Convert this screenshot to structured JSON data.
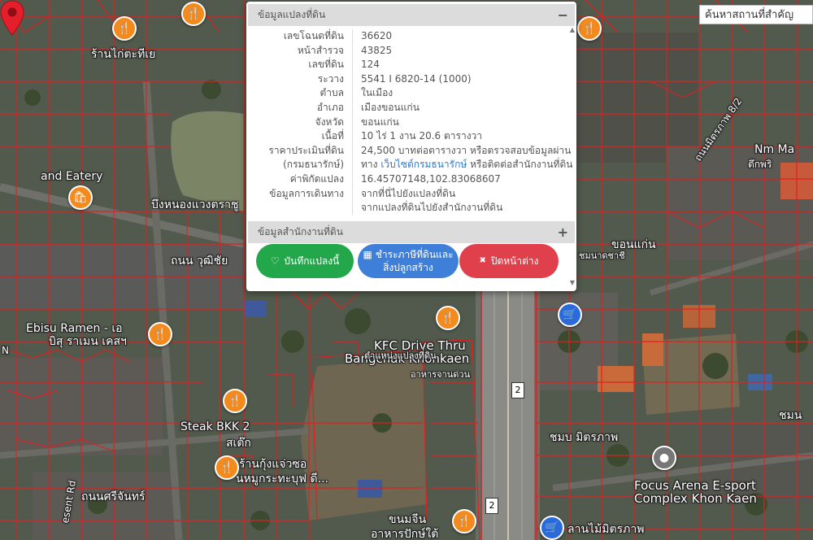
{
  "search": {
    "placeholder": "ค้นหาสถานที่สำคัญ"
  },
  "map_labels": {
    "label_1": "ร้านไก่ตะทีเย",
    "label_2": "and Eatery",
    "label_3": "บึงหนองแวงตราชู",
    "label_4": "ถนน วุฒิชัย",
    "label_5": "Ebisu Ramen - เอ",
    "label_6": "บิสุ ราเมน เคสฯ",
    "label_7": "Steak BKK 2",
    "label_8": "สเต๊ก",
    "label_9": "ร้านกุ้งแจ่วซอ",
    "label_10": "นหมูกระทะบุฟ ดี...",
    "label_11": "ถนนศรีจันทร์",
    "label_12": "KFC Drive Thru",
    "label_13": "Bangchak Khonkaen",
    "label_14": "ตำแหน่งแปลงที่ดิน",
    "label_15": "อาหารจานด่วน",
    "label_16": "Focus Arena E-sport",
    "label_17": "Complex Khon Kaen",
    "label_18": "ลานไม้มิตรภาพ",
    "label_19": "ชมนาดชาชี",
    "label_20": "ขอนแก่น",
    "label_21": "ชมบ มิตรภาพ",
    "label_22": "Nm Ma",
    "label_23": "ตึกพริ",
    "label_24": "ถนนมิตรภาพ 8/2",
    "label_25": "ขนมจีน",
    "label_26": "อาหารปักษ์ใต้",
    "label_27": "ชมน",
    "label_28": "esent Rd",
    "label_29": "N",
    "shield_1": "2",
    "shield_2": "2"
  },
  "panel": {
    "land_section_title": "ข้อมูลแปลงที่ดิน",
    "land_section_toggle": "−",
    "rows": [
      {
        "key": "เลขโฉนดที่ดิน",
        "value": "36620"
      },
      {
        "key": "หน้าสำรวจ",
        "value": "43825"
      },
      {
        "key": "เลขที่ดิน",
        "value": "124"
      },
      {
        "key": "ระวาง",
        "value": "5541 I 6820-14 (1000)"
      },
      {
        "key": "ตำบล",
        "value": "ในเมือง"
      },
      {
        "key": "อำเภอ",
        "value": "เมืองขอนแก่น"
      },
      {
        "key": "จังหวัด",
        "value": "ขอนแก่น"
      },
      {
        "key": "เนื้อที่",
        "value": "10 ไร่ 1 งาน 20.6 ตารางวา"
      },
      {
        "key": "ราคาประเมินที่ดิน",
        "value": "24,500 บาทต่อตารางวา หรือตรวจสอบข้อมูลผ่าน"
      },
      {
        "key": "(กรมธนารักษ์)",
        "value_pre": "ทาง ",
        "value_link": "เว็บไซต์กรมธนารักษ์",
        "value_post": " หรือติดต่อสำนักงานที่ดิน"
      },
      {
        "key": "ค่าพิกัดแปลง",
        "value": "16.45707148,102.83068607"
      },
      {
        "key": "ข้อมูลการเดินทาง",
        "value": "จากที่นี่ไปยังแปลงที่ดิน"
      },
      {
        "key": "",
        "value": "จากแปลงที่ดินไปยังสำนักงานที่ดิน"
      }
    ],
    "office_section_title": "ข้อมูลสำนักงานที่ดิน",
    "office_section_toggle": "+",
    "buttons": {
      "save": "บันทึกแปลงนี้",
      "save_icon": "♡",
      "pay_line1": "ชำระภาษีที่ดินและ",
      "pay_line2": "สิ่งปลูกสร้าง",
      "pay_icon": "▦",
      "close": "ปิดหน้าต่าง",
      "close_icon": "✖"
    }
  },
  "colors": {
    "parcel_line": "#e02020",
    "save_btn": "#22a84a",
    "pay_btn": "#3d7fd9",
    "close_btn": "#e0404c",
    "link": "#2a7ad0",
    "poi": "#f28a1e"
  }
}
